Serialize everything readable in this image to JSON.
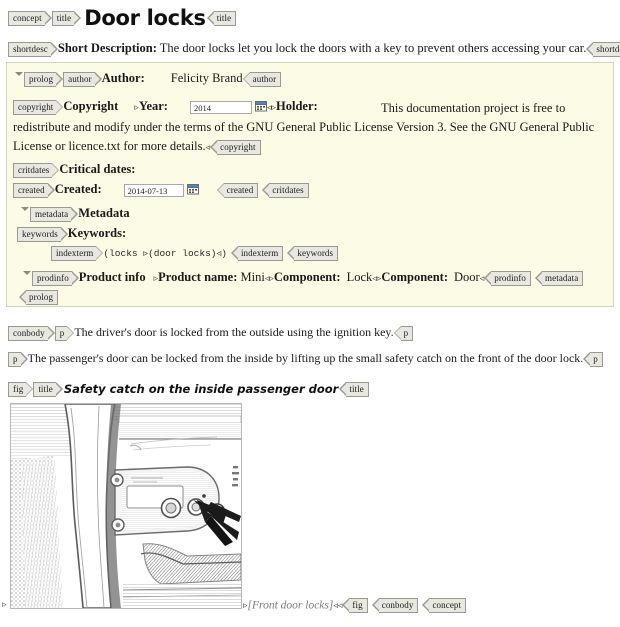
{
  "document": {
    "title": "Door locks",
    "root_tag": "concept",
    "title_tag": "title"
  },
  "shortdesc": {
    "tag": "shortdesc",
    "label": "Short Description:",
    "text": "The door locks let you lock the doors with a key to prevent others accessing your car."
  },
  "prolog": {
    "tag": "prolog",
    "author": {
      "tag": "author",
      "label": "Author:",
      "value": "Felicity Brand"
    },
    "copyright": {
      "tag": "copyright",
      "label": "Copyright",
      "year_label": "Year:",
      "year_value": "2014",
      "holder_label": "Holder:",
      "holder_text": "This documentation project is free to redistribute and modify under the terms of the GNU General Public License Version 3. See the GNU General Public License or licence.txt for more details."
    },
    "critdates": {
      "tag": "critdates",
      "label": "Critical dates:",
      "created": {
        "tag": "created",
        "label": "Created:",
        "value": "2014-07-13"
      }
    },
    "metadata": {
      "tag": "metadata",
      "label": "Metadata",
      "keywords": {
        "tag": "keywords",
        "label": "Keywords:",
        "indexterm_tag": "indexterm",
        "indexterm_text": "(locks  ▹(door locks)◃)"
      },
      "prodinfo": {
        "tag": "prodinfo",
        "label": "Product info",
        "prodname_label": "Product name:",
        "prodname_value": "Mini",
        "component1_label": "Component:",
        "component1_value": "Lock",
        "component2_label": "Component:",
        "component2_value": "Door"
      }
    }
  },
  "conbody": {
    "tag": "conbody",
    "paragraphs": [
      {
        "tag": "p",
        "text": "The driver's door is locked from the outside using the ignition key."
      },
      {
        "tag": "p",
        "text": "The passenger's door can be locked from the inside by lifting up the small safety catch on the front of the door lock."
      }
    ],
    "figure": {
      "tag": "fig",
      "title_tag": "title",
      "title": "Safety catch on the inside passenger door",
      "image_alt": "Front door locks",
      "caption": "[Front door locks]"
    }
  },
  "icons": {
    "calendar": "calendar-picker-icon",
    "fold": "collapse-triangle-icon",
    "boundary_open": "▹",
    "boundary_close": "◃"
  },
  "colors": {
    "prolog_background": "#fbfbe6",
    "prolog_border": "#d3d3bf",
    "tag_background": "#e8e8e0",
    "tag_border": "#9a9a92",
    "caption_text": "#7e7e7e"
  }
}
